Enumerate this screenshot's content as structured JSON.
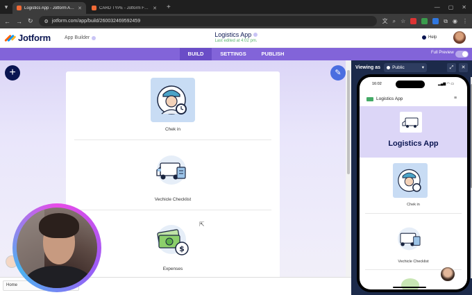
{
  "browser": {
    "tabs": [
      {
        "label": "Logistics App - Jotform App Builder",
        "active": true
      },
      {
        "label": "CARD TYPE - Jotform Form Builder",
        "active": false
      }
    ],
    "url": "jotform.com/app/build/260032469592459"
  },
  "header": {
    "logo": "Jotform",
    "app_builder": "App Builder",
    "app_title": "Logistics App",
    "last_edited": "Last edited at 4:02 pm.",
    "help": "Help"
  },
  "nav": {
    "tabs": [
      {
        "label": "BUILD",
        "active": true
      },
      {
        "label": "SETTINGS",
        "active": false
      },
      {
        "label": "PUBLISH",
        "active": false
      }
    ],
    "full_preview": "Full Preview"
  },
  "builder": {
    "items": [
      {
        "label": "Chek in",
        "icon": "courier-clock-icon"
      },
      {
        "label": "Vechicle Checklist",
        "icon": "van-checklist-icon"
      },
      {
        "label": "Expenses",
        "icon": "money-dollar-icon"
      }
    ]
  },
  "bottom": {
    "home_tab": "Home"
  },
  "preview": {
    "viewing_as": "Viewing as",
    "role": "Public",
    "phone": {
      "time": "16:02",
      "app_name": "Logistics App",
      "title": "Logistics App",
      "items": [
        {
          "label": "Chek in"
        },
        {
          "label": "Vechicle Checklist"
        }
      ]
    }
  },
  "colors": {
    "brand_navy": "#0a1551",
    "nav_purple": "#8264d9",
    "canvas_lavender": "#dcd6f7",
    "preview_bg": "#1c2a4a"
  }
}
